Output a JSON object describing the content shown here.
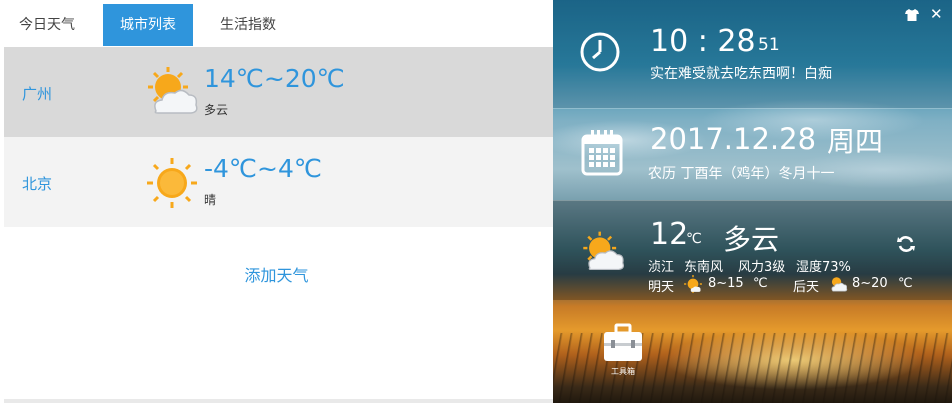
{
  "tabs": [
    {
      "label": "今日天气",
      "active": false
    },
    {
      "label": "城市列表",
      "active": true
    },
    {
      "label": "生活指数",
      "active": false
    }
  ],
  "cities": [
    {
      "name": "广州",
      "temp": "14℃~20℃",
      "desc": "多云",
      "icon": "partly-cloudy-icon"
    },
    {
      "name": "北京",
      "temp": "-4℃~4℃",
      "desc": "晴",
      "icon": "sunny-icon"
    }
  ],
  "add_weather": "添加天气",
  "clock": {
    "hm": "10 : 28",
    "sec": "51",
    "message": "实在难受就去吃东西啊！白痴"
  },
  "date": {
    "date": "2017.12.28",
    "weekday": "周四",
    "lunar": "农历 丁酉年（鸡年）冬月十一"
  },
  "current": {
    "temp": "12",
    "unit": "℃",
    "cond": "多云",
    "details": [
      "浈江",
      "东南风",
      "风力3级",
      "湿度73%"
    ],
    "tomorrow": {
      "label": "明天",
      "range": "8~15",
      "unit": "℃"
    },
    "after": {
      "label": "后天",
      "range": "8~20",
      "unit": "℃"
    }
  },
  "toolbox": {
    "label": "工具箱"
  },
  "colors": {
    "accent": "#2f95dc",
    "selected_row": "#d9d9d9",
    "row": "#f3f3f3"
  }
}
